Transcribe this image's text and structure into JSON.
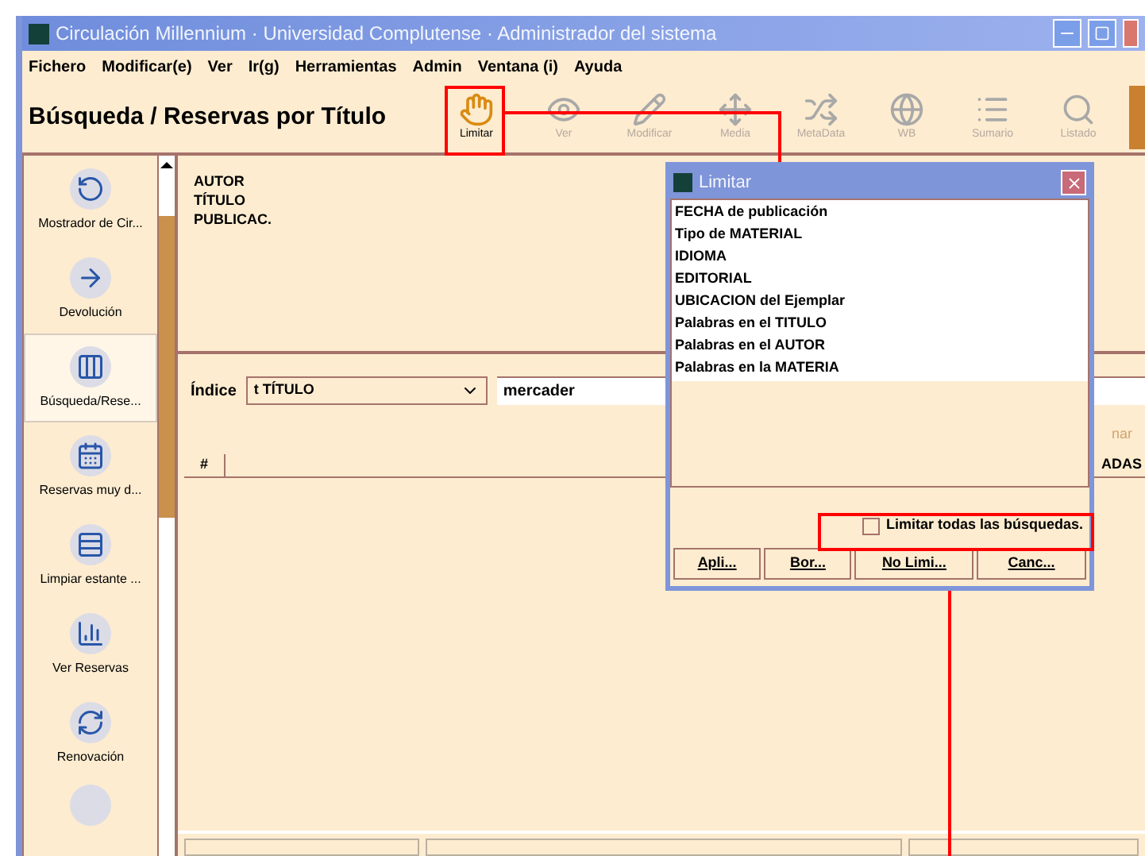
{
  "window": {
    "title": "Circulación Millennium · Universidad Complutense · Administrador del sistema"
  },
  "menu": [
    "Fichero",
    "Modificar(e)",
    "Ver",
    "Ir(g)",
    "Herramientas",
    "Admin",
    "Ventana (i)",
    "Ayuda"
  ],
  "page_title": "Búsqueda / Reservas por Título",
  "toolbar": [
    {
      "label": "Limitar",
      "disabled": false
    },
    {
      "label": "Ver",
      "disabled": true
    },
    {
      "label": "Modificar",
      "disabled": true
    },
    {
      "label": "Media",
      "disabled": true
    },
    {
      "label": "MetaData",
      "disabled": true
    },
    {
      "label": "WB",
      "disabled": true
    },
    {
      "label": "Sumario",
      "disabled": true
    },
    {
      "label": "Listado",
      "disabled": true
    }
  ],
  "sidebar": [
    {
      "label": "Mostrador de Cir...",
      "selected": false
    },
    {
      "label": "Devolución",
      "selected": false
    },
    {
      "label": "Búsqueda/Rese...",
      "selected": true
    },
    {
      "label": "Reservas muy d...",
      "selected": false
    },
    {
      "label": "Limpiar estante ...",
      "selected": false
    },
    {
      "label": "Ver Reservas",
      "selected": false
    },
    {
      "label": "Renovación",
      "selected": false
    }
  ],
  "record_fields": [
    "AUTOR",
    "TÍTULO",
    "PUBLICAC."
  ],
  "search": {
    "index_label": "Índice",
    "index_value": "t TÍTULO",
    "query": "mercader"
  },
  "partial_button": {
    "label": "nar",
    "disabled": true
  },
  "table": {
    "columns": [
      "#"
    ],
    "column_partial": "ADAS"
  },
  "dialog": {
    "title": "Limitar",
    "options": [
      "FECHA de publicación",
      "Tipo de MATERIAL",
      "IDIOMA",
      "EDITORIAL",
      "UBICACION del Ejemplar",
      "Palabras en el TITULO",
      "Palabras en el AUTOR",
      "Palabras en la MATERIA"
    ],
    "limit_all": {
      "label": "Limitar todas las búsquedas.",
      "checked": false
    },
    "buttons": [
      "Apli...",
      "Bor...",
      "No Limi...",
      "Canc..."
    ]
  }
}
